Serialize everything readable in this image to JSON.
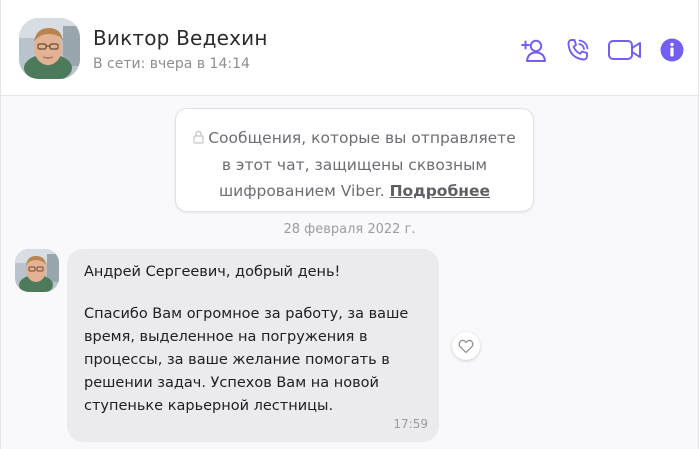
{
  "header": {
    "contact_name": "Виктор Ведехин",
    "status": "В сети: вчера в 14:14",
    "actions": [
      {
        "name": "add-participant",
        "icon": "add-user-icon"
      },
      {
        "name": "voice-call",
        "icon": "phone-icon"
      },
      {
        "name": "video-call",
        "icon": "video-camera-icon"
      },
      {
        "name": "chat-info",
        "icon": "info-icon"
      }
    ],
    "accent_color": "#7360f2"
  },
  "chat": {
    "e2e_notice": {
      "text": "Сообщения, которые вы отправляете в этот чат, защищены сквозным шифрованием Viber.",
      "link": "Подробнее",
      "icon": "lock-icon"
    },
    "date_separator": "28 февраля 2022 г.",
    "messages": [
      {
        "greeting": "Андрей Сергеевич, добрый день!",
        "body": "Спасибо Вам огромное за работу, за ваше время, выделенное на погружения в процессы, за ваше желание помогать в решении задач. Успехов Вам на новой ступеньке карьерной лестницы.",
        "time": "17:59",
        "reaction_icon": "heart-icon"
      }
    ]
  }
}
